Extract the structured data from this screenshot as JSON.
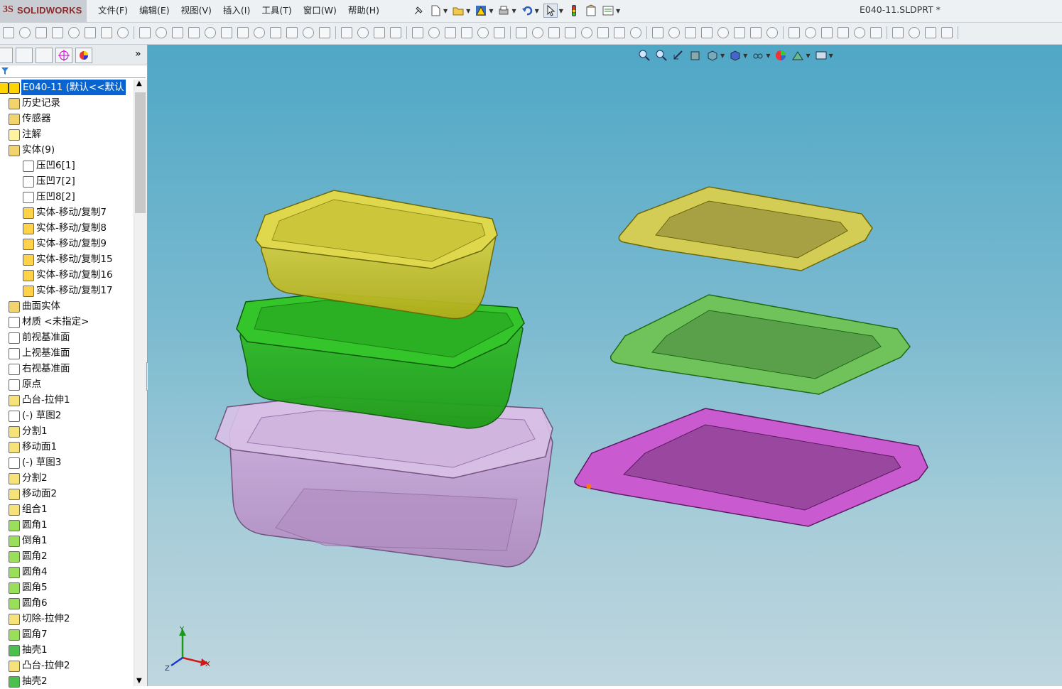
{
  "app": {
    "logo": "SOLIDWORKS",
    "document_title": "E040-11.SLDPRT *"
  },
  "menu": {
    "items": [
      "文件(F)",
      "编辑(E)",
      "视图(V)",
      "插入(I)",
      "工具(T)",
      "窗口(W)",
      "帮助(H)"
    ]
  },
  "tree": {
    "root": "E040-11 (默认<<默认",
    "items": [
      {
        "label": "历史记录",
        "indent": 1
      },
      {
        "label": "传感器",
        "indent": 1
      },
      {
        "label": "注解",
        "indent": 1
      },
      {
        "label": "实体(9)",
        "indent": 1
      },
      {
        "label": "压凹6[1]",
        "indent": 2
      },
      {
        "label": "压凹7[2]",
        "indent": 2
      },
      {
        "label": "压凹8[2]",
        "indent": 2
      },
      {
        "label": "实体-移动/复制7",
        "indent": 2
      },
      {
        "label": "实体-移动/复制8",
        "indent": 2
      },
      {
        "label": "实体-移动/复制9",
        "indent": 2
      },
      {
        "label": "实体-移动/复制15",
        "indent": 2
      },
      {
        "label": "实体-移动/复制16",
        "indent": 2
      },
      {
        "label": "实体-移动/复制17",
        "indent": 2
      },
      {
        "label": "曲面实体",
        "indent": 1
      },
      {
        "label": "材质 <未指定>",
        "indent": 1
      },
      {
        "label": "前视基准面",
        "indent": 1
      },
      {
        "label": "上视基准面",
        "indent": 1
      },
      {
        "label": "右视基准面",
        "indent": 1
      },
      {
        "label": "原点",
        "indent": 1
      },
      {
        "label": "凸台-拉伸1",
        "indent": 1
      },
      {
        "label": "(-) 草图2",
        "indent": 1
      },
      {
        "label": "分割1",
        "indent": 1
      },
      {
        "label": "移动面1",
        "indent": 1
      },
      {
        "label": "(-) 草图3",
        "indent": 1
      },
      {
        "label": "分割2",
        "indent": 1
      },
      {
        "label": "移动面2",
        "indent": 1
      },
      {
        "label": "组合1",
        "indent": 1
      },
      {
        "label": "圆角1",
        "indent": 1
      },
      {
        "label": "倒角1",
        "indent": 1
      },
      {
        "label": "圆角2",
        "indent": 1
      },
      {
        "label": "圆角4",
        "indent": 1
      },
      {
        "label": "圆角5",
        "indent": 1
      },
      {
        "label": "圆角6",
        "indent": 1
      },
      {
        "label": "切除-拉伸2",
        "indent": 1
      },
      {
        "label": "圆角7",
        "indent": 1
      },
      {
        "label": "抽壳1",
        "indent": 1
      },
      {
        "label": "凸台-拉伸2",
        "indent": 1
      },
      {
        "label": "抽壳2",
        "indent": 1
      }
    ]
  },
  "colors": {
    "yellow": "#c9c42b",
    "green": "#23b41c",
    "purple": "#c79bd6",
    "lid_yellow": "#d4cd55",
    "lid_green": "#6fc35a",
    "lid_purple": "#c95ad0"
  },
  "triad": {
    "x": "X",
    "y": "Y",
    "z": "Z"
  }
}
